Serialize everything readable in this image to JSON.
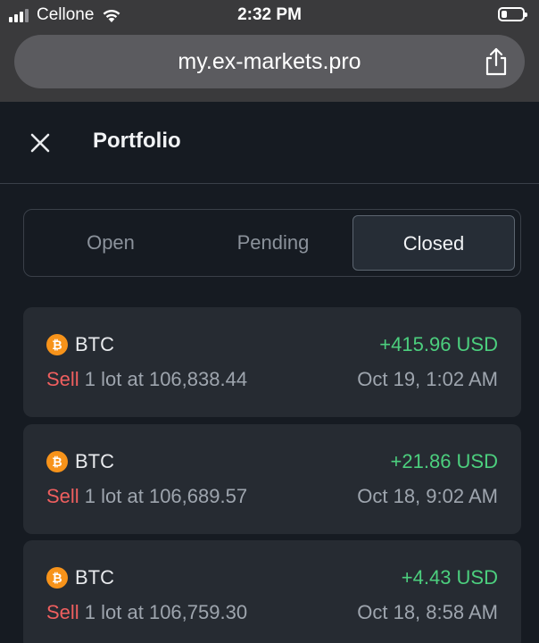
{
  "status": {
    "carrier": "Cellone",
    "time": "2:32 PM"
  },
  "browser": {
    "url": "my.ex-markets.pro"
  },
  "header": {
    "title": "Portfolio"
  },
  "tabs": [
    {
      "label": "Open"
    },
    {
      "label": "Pending"
    },
    {
      "label": "Closed"
    }
  ],
  "trades": [
    {
      "coin_glyph": "₿",
      "symbol": "BTC",
      "pnl": "+415.96 USD",
      "side": "Sell",
      "detail": " 1 lot at 106,838.44",
      "date": "Oct 19, 1:02 AM"
    },
    {
      "coin_glyph": "₿",
      "symbol": "BTC",
      "pnl": "+21.86 USD",
      "side": "Sell",
      "detail": " 1 lot at 106,689.57",
      "date": "Oct 18, 9:02 AM"
    },
    {
      "coin_glyph": "₿",
      "symbol": "BTC",
      "pnl": "+4.43 USD",
      "side": "Sell",
      "detail": " 1 lot at 106,759.30",
      "date": "Oct 18, 8:58 AM"
    }
  ],
  "colors": {
    "profit": "#4ccf7e",
    "sell": "#ef5f5f",
    "coin": "#f7931a",
    "background": "#161b22",
    "card": "#262b32"
  },
  "icons": {
    "close": "close-icon",
    "share": "share-icon",
    "coin": "bitcoin-icon",
    "signal": "signal-icon",
    "wifi": "wifi-icon",
    "battery": "battery-icon"
  }
}
